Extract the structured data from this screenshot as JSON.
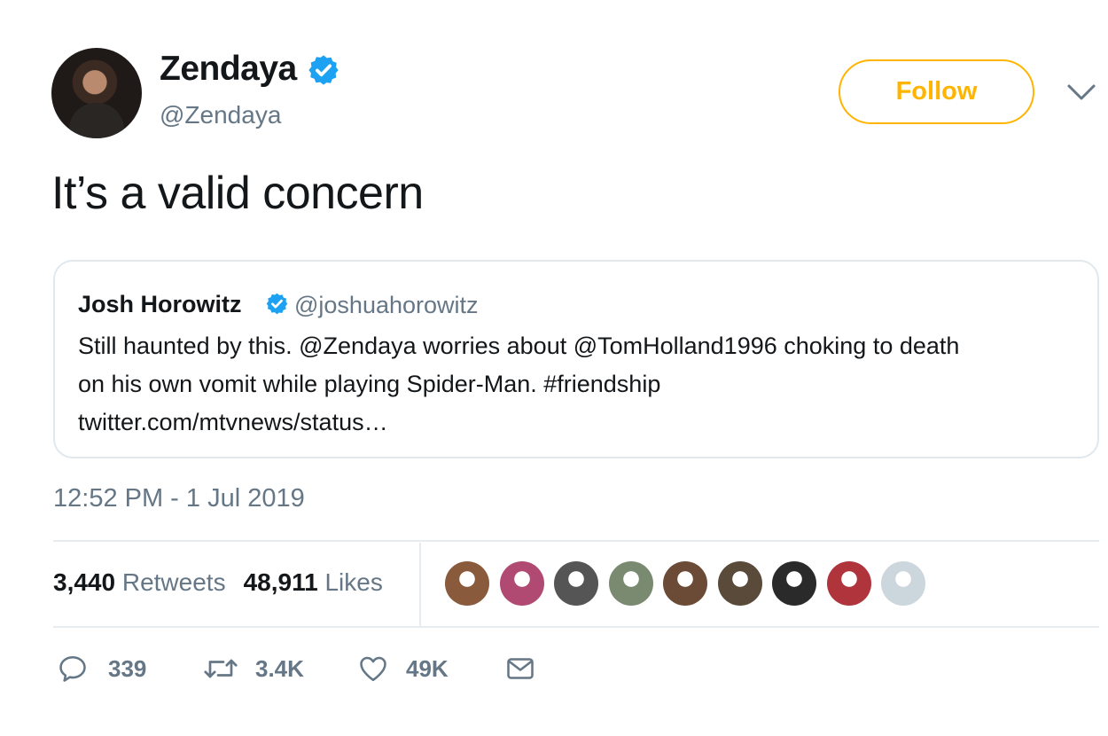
{
  "author": {
    "display_name": "Zendaya",
    "handle": "@Zendaya",
    "verified": true
  },
  "follow_button": {
    "label": "Follow",
    "color": "#ffb400"
  },
  "tweet": {
    "text": "It’s a valid concern",
    "timestamp": "12:52 PM - 1 Jul 2019"
  },
  "quoted_tweet": {
    "display_name": "Josh Horowitz",
    "handle": "@joshuahorowitz",
    "verified": true,
    "text_line1": "Still haunted by this. @Zendaya worries about @TomHolland1996 choking to death",
    "text_line2": "on his own vomit while playing Spider-Man. #friendship",
    "text_line3": "twitter.com/mtvnews/status…"
  },
  "stats": {
    "retweets_count": "3,440",
    "retweets_label": "Retweets",
    "likes_count": "48,911",
    "likes_label": "Likes"
  },
  "liker_avatars": [
    {
      "name": "liker-avatar-1",
      "color": "#8a5a3c"
    },
    {
      "name": "liker-avatar-2",
      "color": "#b04a72"
    },
    {
      "name": "liker-avatar-3",
      "color": "#555555"
    },
    {
      "name": "liker-avatar-4",
      "color": "#7a8a70"
    },
    {
      "name": "liker-avatar-5",
      "color": "#6b4a36"
    },
    {
      "name": "liker-avatar-6",
      "color": "#5a4a3a"
    },
    {
      "name": "liker-avatar-7",
      "color": "#2a2a2a"
    },
    {
      "name": "liker-avatar-8",
      "color": "#b0343c"
    },
    {
      "name": "liker-avatar-9",
      "color": "#ccd6dd"
    }
  ],
  "actions": {
    "reply_count": "339",
    "retweet_count": "3.4K",
    "like_count": "49K"
  },
  "icons": {
    "verified": "verified-badge-icon",
    "chevron": "chevron-down-icon",
    "reply": "reply-icon",
    "retweet": "retweet-icon",
    "like": "heart-icon",
    "message": "envelope-icon"
  },
  "colors": {
    "verified_blue": "#1da1f2",
    "secondary_text": "#657786",
    "primary_text": "#14171a",
    "follow_accent": "#ffb400"
  }
}
